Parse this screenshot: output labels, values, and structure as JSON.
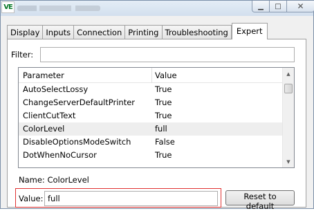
{
  "window": {
    "logo_text": "VE",
    "controls": {
      "minimize": "▁",
      "maximize": "□",
      "close": "✕"
    }
  },
  "tabs": [
    {
      "label": "Display"
    },
    {
      "label": "Inputs"
    },
    {
      "label": "Connection"
    },
    {
      "label": "Printing"
    },
    {
      "label": "Troubleshooting"
    },
    {
      "label": "Expert",
      "active": true
    }
  ],
  "filter": {
    "label": "Filter:",
    "value": ""
  },
  "table": {
    "columns": [
      "Parameter",
      "Value"
    ],
    "rows": [
      {
        "parameter": "AutoSelectLossy",
        "value": "True"
      },
      {
        "parameter": "ChangeServerDefaultPrinter",
        "value": "True"
      },
      {
        "parameter": "ClientCutText",
        "value": "True"
      },
      {
        "parameter": "ColorLevel",
        "value": "full",
        "selected": true
      },
      {
        "parameter": "DisableOptionsModeSwitch",
        "value": "False"
      },
      {
        "parameter": "DotWhenNoCursor",
        "value": "True"
      }
    ]
  },
  "selected": {
    "name_line": "Name: ColorLevel",
    "value_label": "Value:",
    "value": "full"
  },
  "buttons": {
    "reset": "Reset to default"
  },
  "colors": {
    "highlight_border": "#e03030",
    "selected_row": "#eeeeee"
  }
}
